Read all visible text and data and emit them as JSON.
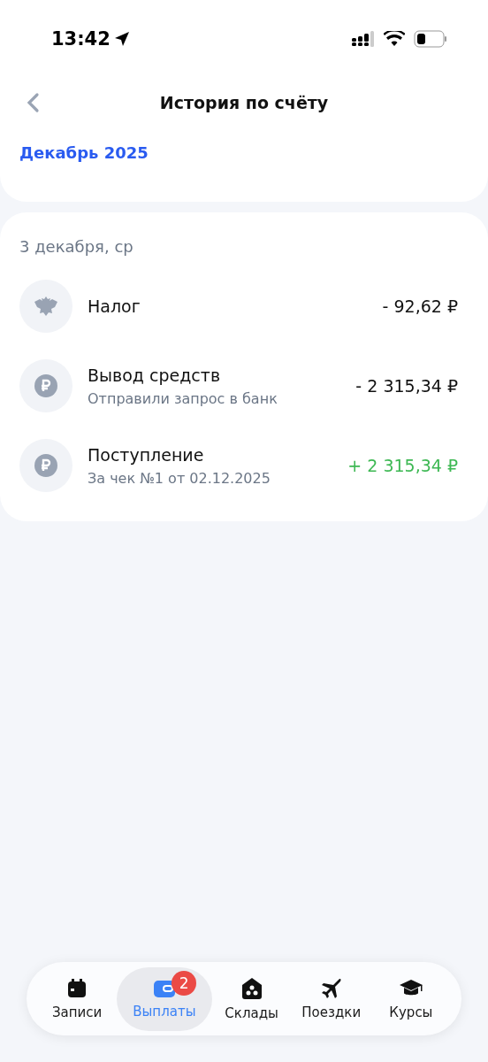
{
  "status_bar": {
    "time": "13:42"
  },
  "header": {
    "title": "История по счёту",
    "month": "Декабрь 2025"
  },
  "day": {
    "date": "3 декабря, ср",
    "transactions": [
      {
        "kind": "emblem",
        "title": "Налог",
        "amount": "- 92,62 ₽",
        "credit": false
      },
      {
        "kind": "ruble",
        "title": "Вывод средств",
        "subtitle": "Отправили запрос в банк",
        "amount": "- 2 315,34 ₽",
        "credit": false
      },
      {
        "kind": "ruble",
        "title": "Поступление",
        "subtitle": "За чек №1 от 02.12.2025",
        "amount": "+ 2 315,34 ₽",
        "credit": true
      }
    ]
  },
  "tabs": [
    {
      "kind": "calendar",
      "label": "Записи",
      "selected": false
    },
    {
      "kind": "wallet",
      "label": "Выплаты",
      "selected": true,
      "badge": "2"
    },
    {
      "kind": "house",
      "label": "Склады",
      "selected": false
    },
    {
      "kind": "plane",
      "label": "Поездки",
      "selected": false
    },
    {
      "kind": "cap",
      "label": "Курсы",
      "selected": false
    }
  ]
}
